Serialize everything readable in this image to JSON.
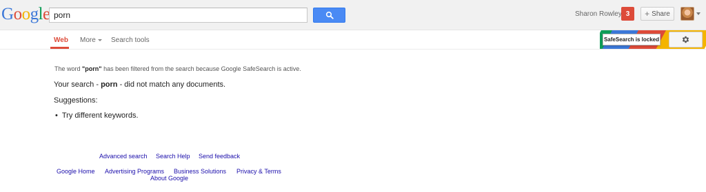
{
  "logo": {
    "letters": [
      "G",
      "o",
      "o",
      "g",
      "l",
      "e"
    ],
    "colors": [
      "#3c78d8",
      "#dd4b39",
      "#f4b400",
      "#3c78d8",
      "#0f9d58",
      "#dd4b39"
    ]
  },
  "search": {
    "value": "porn",
    "button_icon": "search-icon"
  },
  "header": {
    "user_name": "Sharon Rowley",
    "notification_count": "3",
    "share_label": "Share",
    "avatar_icon": "avatar-photo"
  },
  "nav": {
    "web": "Web",
    "more": "More",
    "search_tools": "Search tools"
  },
  "safesearch": {
    "badge": "SafeSearch is locked",
    "settings_icon": "gear-icon",
    "stripe_colors": [
      "#3c78d8",
      "#dd4b39",
      "#f4b400",
      "#0f9d58"
    ]
  },
  "results": {
    "filtered_prefix": "The word ",
    "filtered_term": "\"porn\"",
    "filtered_suffix": " has been filtered from the search because Google SafeSearch is active.",
    "no_match_prefix": "Your search - ",
    "no_match_term": "porn",
    "no_match_suffix": " - did not match any documents.",
    "suggestions_label": "Suggestions:",
    "suggestions": [
      "Try different keywords."
    ]
  },
  "footer": {
    "advanced_search": "Advanced search",
    "search_help": "Search Help",
    "send_feedback": "Send feedback",
    "google_home": "Google Home",
    "advertising_programs": "Advertising Programs",
    "business_solutions": "Business Solutions",
    "privacy_terms": "Privacy & Terms",
    "about_google": "About Google"
  },
  "colors": {
    "accent_red": "#dd4b39",
    "link_blue": "#1a0dab",
    "button_blue": "#4a8af4"
  }
}
